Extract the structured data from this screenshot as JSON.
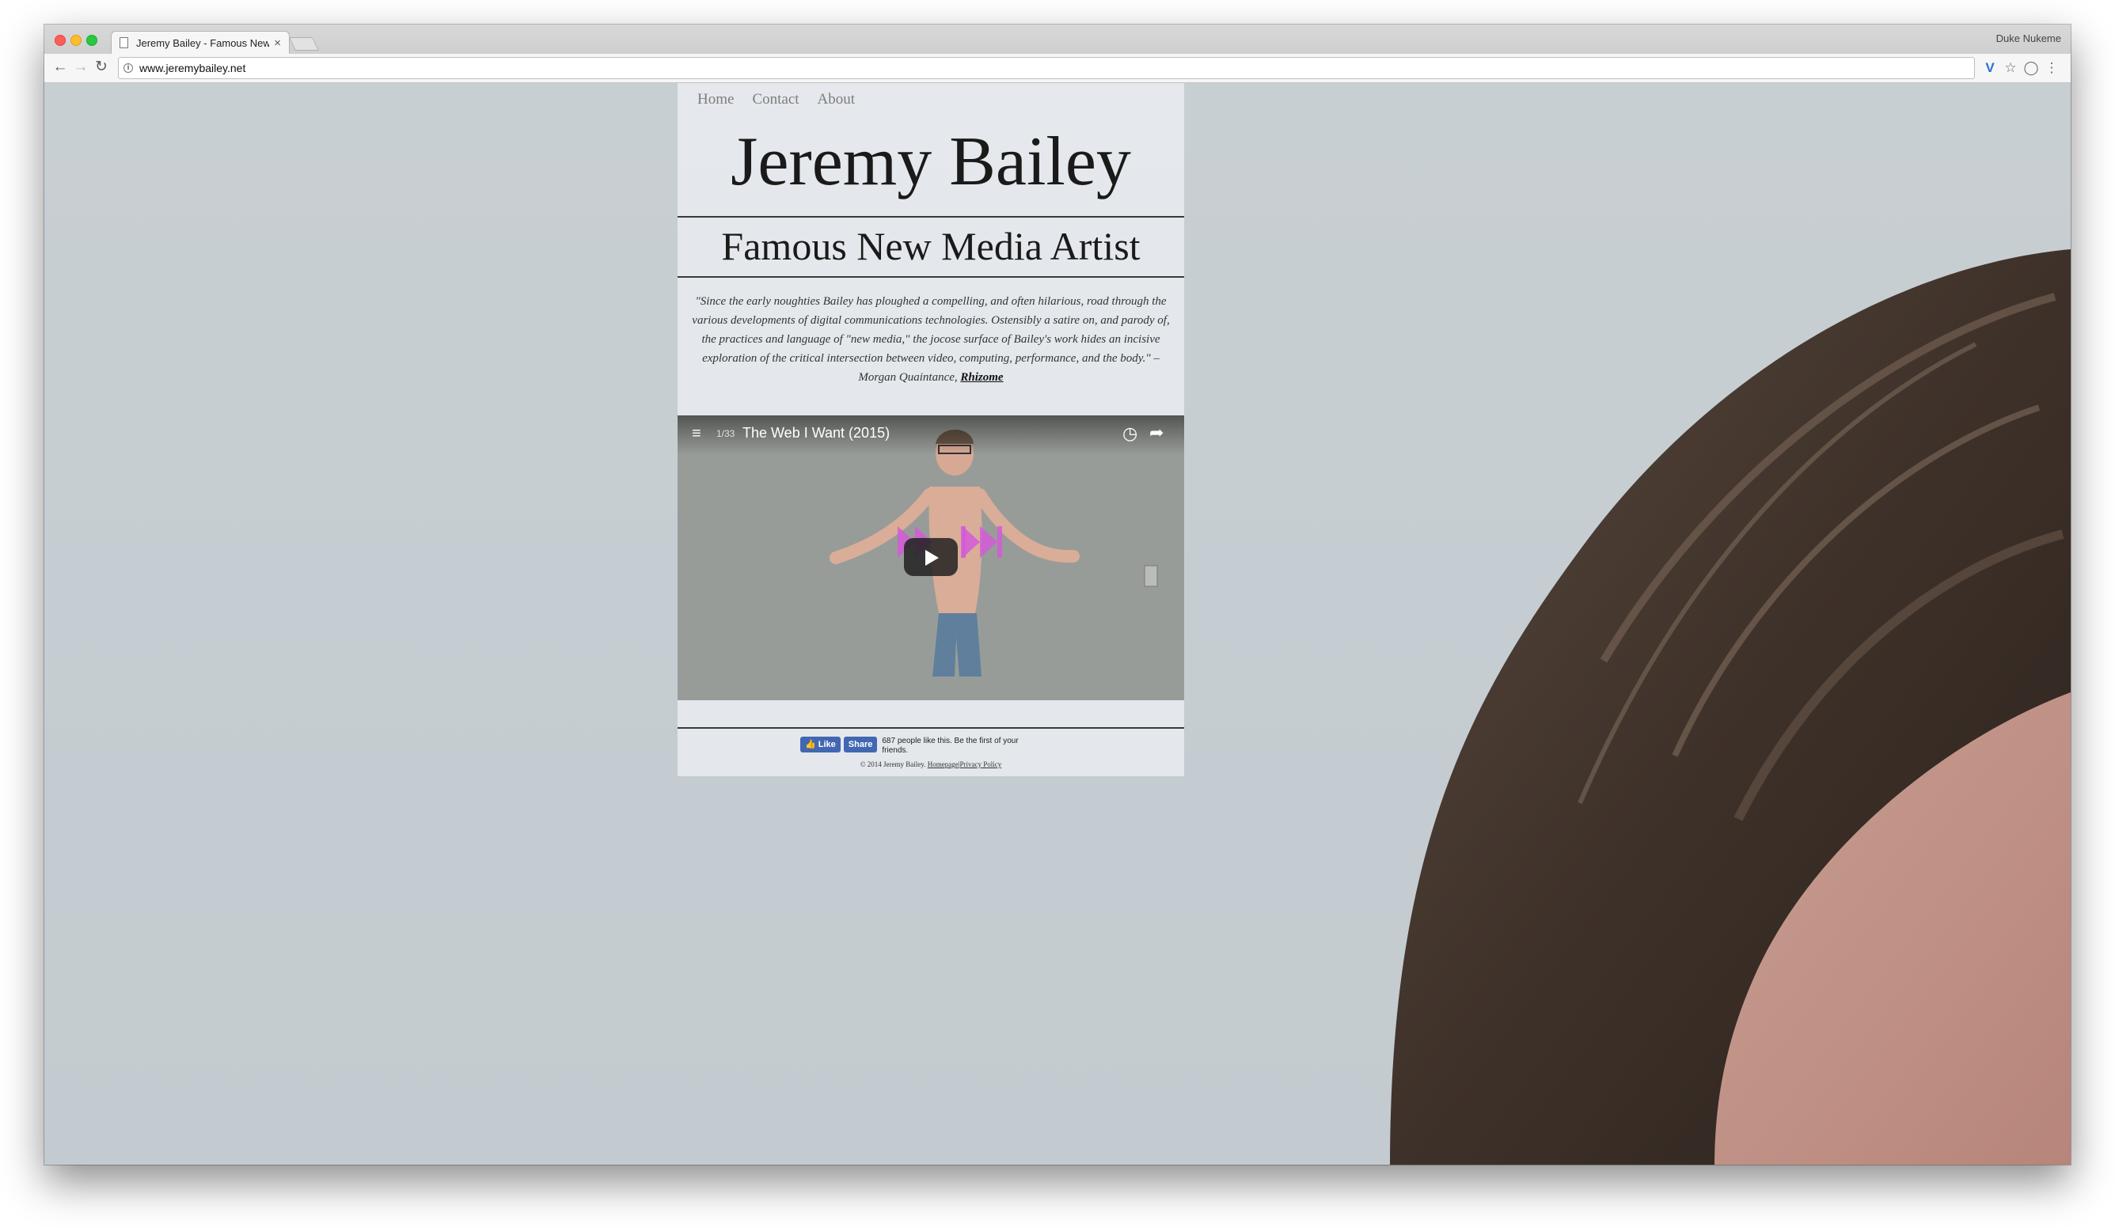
{
  "browser": {
    "tab_title": "Jeremy Bailey - Famous New",
    "tab_close": "×",
    "profile_name": "Duke Nukeme",
    "url": "www.jeremybailey.net",
    "icons": {
      "back": "arrow-left-icon",
      "forward": "arrow-right-icon",
      "reload": "reload-icon",
      "info": "info-icon",
      "extension": "v-extension-icon",
      "bookmark": "star-icon",
      "shield": "shield-icon",
      "menu": "kebab-menu-icon"
    }
  },
  "site": {
    "nav": [
      "Home",
      "Contact",
      "About"
    ],
    "title": "Jeremy Bailey",
    "subtitle": "Famous New Media Artist",
    "quote": "\"Since the early noughties Bailey has ploughed a compelling, and often hilarious, road through the various developments of digital communications technologies. Ostensibly a satire on, and parody of, the practices and language of \"new media,\" the jocose surface of Bailey's work hides an incisive exploration of the critical intersection between video, computing, performance, and the body.\" – Morgan Quaintance,",
    "quote_source": "Rhizome",
    "video": {
      "playlist_count": "1/33",
      "title": "The Web I Want (2015)"
    },
    "facebook": {
      "like_label": "Like",
      "share_label": "Share",
      "text": "687 people like this. Be the first of your friends."
    },
    "footer": {
      "copyright": "© 2014 Jeremy Bailey.",
      "homepage_link": "Homepage",
      "separator": "|",
      "privacy_link": "Privacy Policy"
    }
  },
  "colors": {
    "page_background": "#c8cfd3",
    "fb_blue": "#4267b2",
    "magenta_overlay": "#d35ad8"
  }
}
